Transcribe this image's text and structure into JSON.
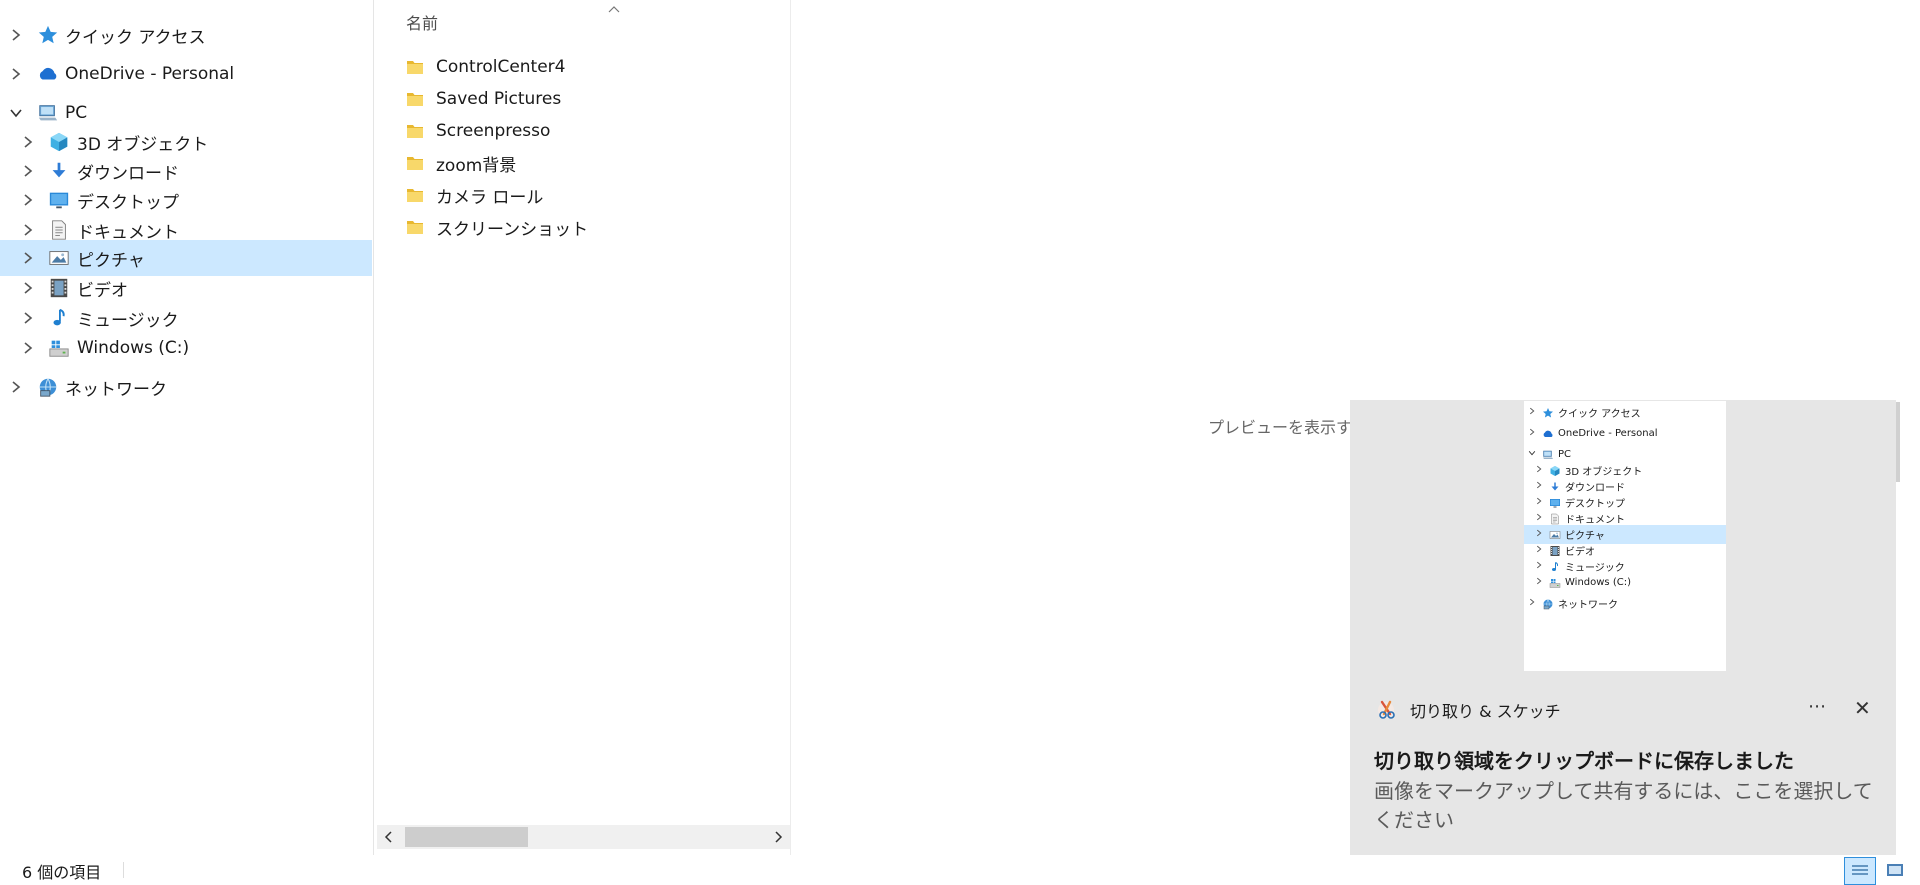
{
  "navigation": {
    "items": [
      {
        "label": "クイック アクセス",
        "icon": "quick-access-star-icon",
        "level": 0,
        "expanded": false,
        "selected": false
      },
      {
        "label": "OneDrive - Personal",
        "icon": "onedrive-cloud-icon",
        "level": 0,
        "expanded": false,
        "selected": false
      },
      {
        "label": "PC",
        "icon": "pc-icon",
        "level": 0,
        "expanded": true,
        "selected": false
      },
      {
        "label": "3D オブジェクト",
        "icon": "3d-objects-icon",
        "level": 1,
        "expanded": false,
        "selected": false
      },
      {
        "label": "ダウンロード",
        "icon": "downloads-icon",
        "level": 1,
        "expanded": false,
        "selected": false
      },
      {
        "label": "デスクトップ",
        "icon": "desktop-icon",
        "level": 1,
        "expanded": false,
        "selected": false
      },
      {
        "label": "ドキュメント",
        "icon": "documents-icon",
        "level": 1,
        "expanded": false,
        "selected": false
      },
      {
        "label": "ピクチャ",
        "icon": "pictures-icon",
        "level": 1,
        "expanded": false,
        "selected": true
      },
      {
        "label": "ビデオ",
        "icon": "videos-icon",
        "level": 1,
        "expanded": false,
        "selected": false
      },
      {
        "label": "ミュージック",
        "icon": "music-icon",
        "level": 1,
        "expanded": false,
        "selected": false
      },
      {
        "label": "Windows (C:)",
        "icon": "drive-icon",
        "level": 1,
        "expanded": false,
        "selected": false
      },
      {
        "label": "ネットワーク",
        "icon": "network-icon",
        "level": 0,
        "expanded": false,
        "selected": false
      }
    ]
  },
  "filelist": {
    "column_header": "名前",
    "files": [
      {
        "name": "ControlCenter4",
        "icon": "folder-icon"
      },
      {
        "name": "Saved Pictures",
        "icon": "folder-icon"
      },
      {
        "name": "Screenpresso",
        "icon": "folder-icon"
      },
      {
        "name": "zoom背景",
        "icon": "folder-icon"
      },
      {
        "name": "カメラ ロール",
        "icon": "folder-icon"
      },
      {
        "name": "スクリーンショット",
        "icon": "folder-icon"
      }
    ]
  },
  "preview": {
    "message": "プレビューを表示する"
  },
  "statusbar": {
    "item_count": "6 個の項目"
  },
  "toast": {
    "app_name": "切り取り & スケッチ",
    "title": "切り取り領域をクリップボードに保存しました",
    "body": "画像をマークアップして共有するには、ここを選択してください",
    "more_label": "⋯",
    "close_label": "✕"
  },
  "colors": {
    "selection": "#cce8ff",
    "folder": "#f7c948",
    "toast_bg": "#e6e6e6"
  }
}
